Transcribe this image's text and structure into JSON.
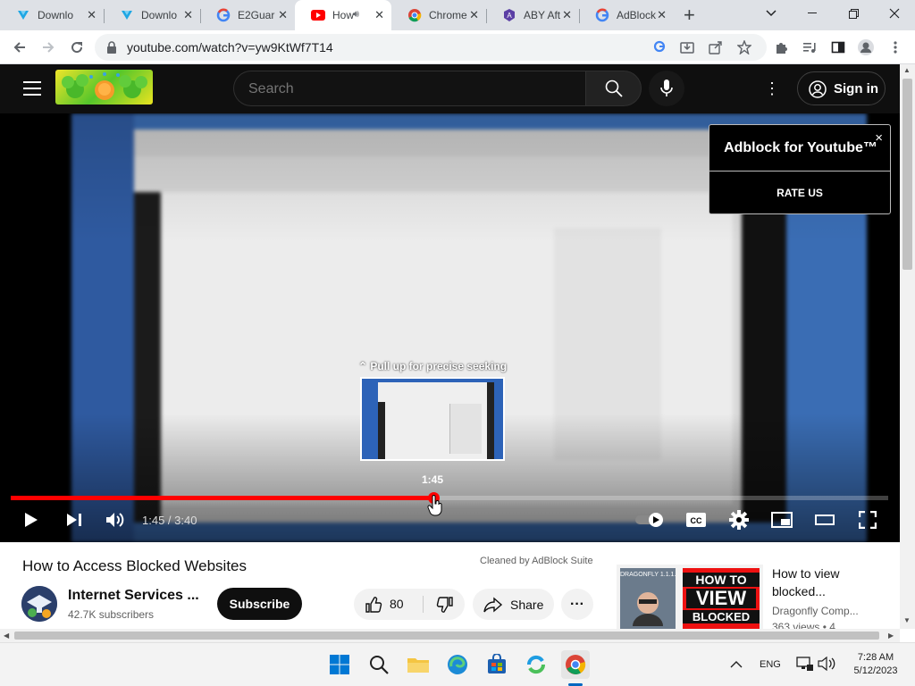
{
  "browser": {
    "tabs": [
      {
        "label": "Downlo",
        "icon": "download-tool-icon",
        "active": false
      },
      {
        "label": "Downlo",
        "icon": "download-tool-icon",
        "active": false
      },
      {
        "label": "E2Guar",
        "icon": "google-icon",
        "active": false
      },
      {
        "label": "How",
        "icon": "youtube-icon",
        "active": true
      },
      {
        "label": "Chrome",
        "icon": "chrome-icon",
        "active": false
      },
      {
        "label": "ABY Aft",
        "icon": "adblock-icon",
        "active": false
      },
      {
        "label": "AdBlock",
        "icon": "google-icon",
        "active": false
      }
    ],
    "new_tab_label": "+",
    "url": "youtube.com/watch?v=yw9KtWf7T14"
  },
  "youtube": {
    "search_placeholder": "Search",
    "signin_label": "Sign in"
  },
  "adblock_popup": {
    "title": "Adblock for Youtube™",
    "rate_label": "RATE US",
    "close_glyph": "×"
  },
  "player": {
    "seek_hint": "Pull up for precise seeking",
    "preview_time": "1:45",
    "current_time": "1:45",
    "duration": "3:40",
    "time_display": "1:45 / 3:40",
    "played_fraction": 0.4814,
    "buffered_fraction": 0.48
  },
  "video": {
    "title": "How to Access Blocked Websites",
    "cleaned_by": "Cleaned by AdBlock Suite",
    "channel": "Internet Services ...",
    "subscribers": "42.7K subscribers",
    "subscribe_label": "Subscribe",
    "likes": "80",
    "share_label": "Share"
  },
  "recommendation": {
    "thumb_line1": "HOW TO",
    "thumb_line2": "VIEW",
    "thumb_line3": "BLOCKED",
    "thumb_badge": "DRAGONFLY 1.1.1.1",
    "title": "How to view blocked...",
    "channel": "Dragonfly Comp...",
    "views": "363 views • 4"
  },
  "taskbar": {
    "lang": "ENG",
    "time": "7:28 AM",
    "date": "5/12/2023"
  },
  "colors": {
    "youtube_red": "#ff0000",
    "header_bg": "#0f0f0f",
    "accent_blue": "#1a73e8"
  }
}
